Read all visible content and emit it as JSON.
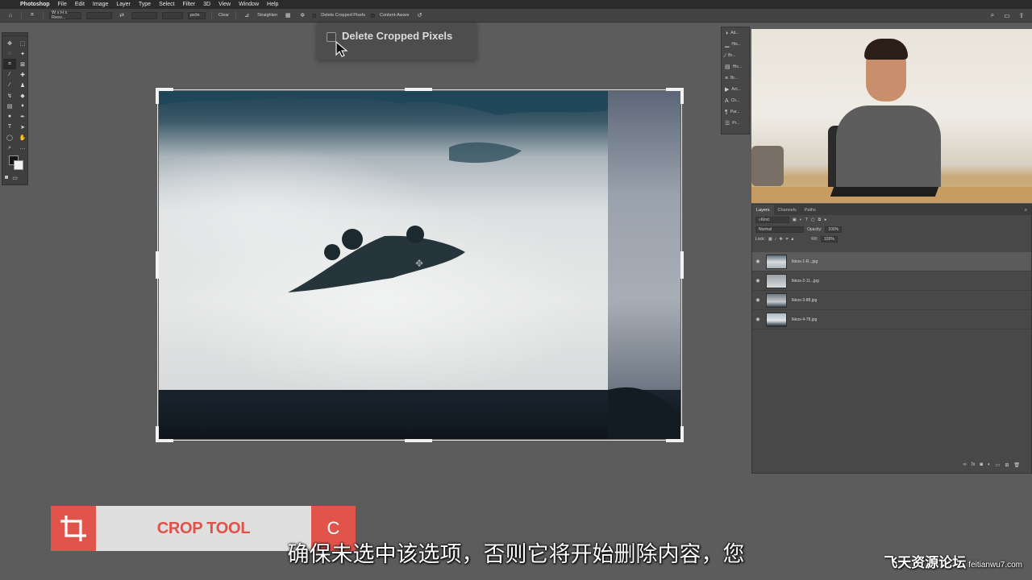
{
  "menubar": {
    "apple_icon": "apple-icon",
    "items": [
      "Photoshop",
      "File",
      "Edit",
      "Image",
      "Layer",
      "Type",
      "Select",
      "Filter",
      "3D",
      "View",
      "Window",
      "Help"
    ]
  },
  "options_bar": {
    "ratio_label": "W x H x Reso...",
    "units_label": "px/in",
    "clear_label": "Clear",
    "straighten_label": "Straighten",
    "delete_cropped_label": "Delete Cropped Pixels",
    "content_aware_label": "Content-Aware"
  },
  "callout": {
    "label": "Delete Cropped Pixels"
  },
  "panel_strip": [
    "Ad...",
    "His...",
    "Br...",
    "His...",
    "Br...",
    "Act...",
    "Ch...",
    "Par...",
    "Pr..."
  ],
  "layers_panel": {
    "tabs": [
      "Layers",
      "Channels",
      "Paths"
    ],
    "kind_label": "Kind",
    "blend_mode": "Normal",
    "opacity_label": "Opacity:",
    "opacity_value": "100%",
    "lock_label": "Lock:",
    "fill_label": "Fill:",
    "fill_value": "100%",
    "layers": [
      {
        "name": "Ikkos-1-R...jpg"
      },
      {
        "name": "Ikkos-2-11...jpg"
      },
      {
        "name": "Ikkos-3-88.jpg"
      },
      {
        "name": "Ikkos-4-78.jpg"
      }
    ]
  },
  "lower_third": {
    "tool_name": "CROP TOOL",
    "shortcut": "C"
  },
  "subtitle": "确保未选中该选项，否则它将开始删除内容，您",
  "watermark": {
    "brand": "飞天资源论坛",
    "site": "feitianwu7.com"
  },
  "colors": {
    "accent": "#e0544c",
    "ps_dark": "#2b2b2b",
    "ps_panel": "#484848"
  }
}
